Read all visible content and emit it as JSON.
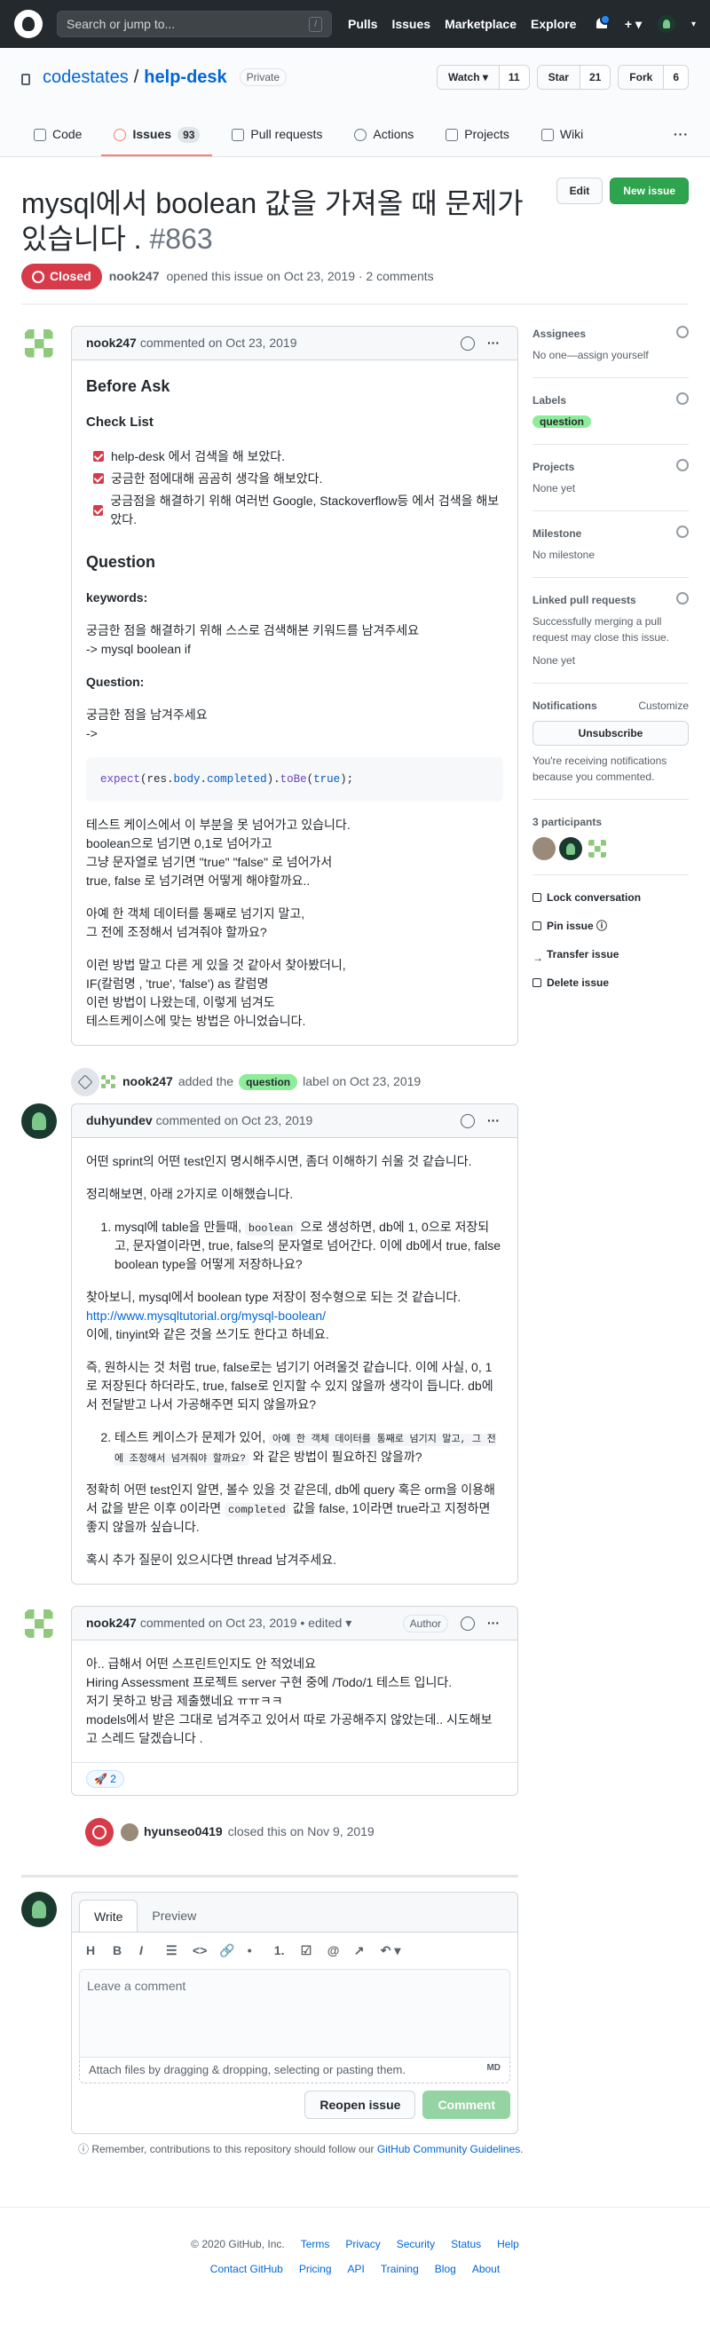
{
  "header": {
    "search_placeholder": "Search or jump to...",
    "search_key": "/",
    "nav": [
      "Pulls",
      "Issues",
      "Marketplace",
      "Explore"
    ],
    "plus": "+ ▾"
  },
  "repo": {
    "owner": "codestates",
    "sep": "/",
    "name": "help-desk",
    "visibility": "Private",
    "watch_label": "Watch ▾",
    "watch_count": "11",
    "star_label": "Star",
    "star_count": "21",
    "fork_label": "Fork",
    "fork_count": "6"
  },
  "tabs": [
    {
      "label": "Code"
    },
    {
      "label": "Issues",
      "count": "93"
    },
    {
      "label": "Pull requests"
    },
    {
      "label": "Actions"
    },
    {
      "label": "Projects"
    },
    {
      "label": "Wiki"
    }
  ],
  "issue": {
    "title": "mysql에서 boolean 값을 가져올 때 문제가 있습니다 .",
    "number": "#863",
    "edit_label": "Edit",
    "new_issue_label": "New issue",
    "status": "Closed",
    "author": "nook247",
    "meta": "opened this issue on Oct 23, 2019 · 2 comments"
  },
  "comments": [
    {
      "author": "nook247",
      "meta": "commented on Oct 23, 2019",
      "h_before": "Before Ask",
      "h_check": "Check List",
      "checks": [
        "help-desk 에서 검색을 해 보았다.",
        "궁금한 점에대해 곰곰히 생각을 해보았다.",
        "궁금점을 해결하기 위해 여러번 Google, Stackoverflow등 에서 검색을 해보았다."
      ],
      "h_question": "Question",
      "h_keywords": "keywords:",
      "kw1": "궁금한 점을 해결하기 위해 스스로 검색해본 키워드를 남겨주세요",
      "kw2": "-> mysql boolean if",
      "h_q": "Question:",
      "q1": "궁금한 점을 남겨주세요",
      "q2": "->",
      "code_fn": "expect",
      "code_a": "(res.",
      "code_b": "body",
      "code_c": ".",
      "code_d": "completed",
      "code_e": ").",
      "code_f": "toBe",
      "code_g": "(",
      "code_h": "true",
      "code_i": ");",
      "p1": [
        "테스트 케이스에서 이 부분을 못 넘어가고 있습니다.",
        "boolean으로 넘기면 0,1로 넘어가고",
        "그냥 문자열로 넘기면 \"true\" \"false\" 로 넘어가서",
        "true, false 로 넘기려면 어떻게 해야할까요.."
      ],
      "p2": [
        "아예 한 객체 데이터를 통째로 넘기지 말고,",
        "그 전에 조정해서 넘겨줘야 할까요?"
      ],
      "p3": [
        "이런 방법 말고 다른 게 있을 것 같아서 찾아봤더니,",
        "IF(칼럼명 , 'true', 'false') as 칼럼명",
        "이런 방법이 나왔는데, 이렇게 넘겨도",
        "테스트케이스에 맞는 방법은 아니었습니다."
      ]
    },
    {
      "author": "duhyundev",
      "meta": "commented on Oct 23, 2019",
      "p1": "어떤 sprint의 어떤 test인지 명시해주시면, 좀더 이해하기 쉬울 것 같습니다.",
      "p2": "정리해보면, 아래 2가지로 이해했습니다.",
      "li1_a": "mysql에 table을 만들때,",
      "li1_code": "boolean",
      "li1_b": "으로 생성하면, db에 1, 0으로 저장되고, 문자열이라면, true, false의 문자열로 넘어간다. 이에 db에서 true, false boolean type을 어떻게 저장하나요?",
      "p3": "찾아보니, mysql에서 boolean type 저장이 정수형으로 되는 것 같습니다.",
      "link": "http://www.mysqltutorial.org/mysql-boolean/",
      "p4": "이에, tinyint와 같은 것을 쓰기도 한다고 하네요.",
      "p5": "즉, 원하시는 것 처럼 true, false로는 넘기기 어려울것 같습니다. 이에 사실, 0, 1로 저장된다 하더라도, true, false로 인지할 수 있지 않을까 생각이 듭니다. db에서 전달받고 나서 가공해주면 되지 않을까요?",
      "li2_a": "테스트 케이스가 문제가 있어,",
      "li2_code": "아예 한 객체 데이터를 통째로 넘기지 말고, 그 전에 조정해서 넘겨줘야 할까요?",
      "li2_b": "와 같은 방법이 필요하진 않을까?",
      "p6_a": "정확히 어떤 test인지 알면, 볼수 있을 것 같은데, db에 query 혹은 orm을 이용해서 값을 받은 이후 0이라면",
      "p6_code": "completed",
      "p6_b": "값을 false, 1이라면 true라고 지정하면 좋지 않을까 싶습니다.",
      "p7": "혹시 추가 질문이 있으시다면 thread 남겨주세요."
    },
    {
      "author": "nook247",
      "meta": "commented on Oct 23, 2019 • edited ▾",
      "badge": "Author",
      "lines": [
        "아.. 급해서 어떤 스프린트인지도 안 적었네요",
        "Hiring Assessment 프로젝트 server 구현 중에 /Todo/1 테스트 입니다.",
        "저기 못하고 방금 제출했네요 ㅠㅠㅋㅋ",
        "models에서 받은 그대로 넘겨주고 있어서 따로 가공해주지 않았는데.. 시도해보고 스레드 달겠습니다 ."
      ],
      "reaction": "🚀 2"
    }
  ],
  "events": {
    "label_author": "nook247",
    "label_mid": "added the",
    "label_name": "question",
    "label_tail": "label on Oct 23, 2019",
    "close_author": "hyunseo0419",
    "close_tail": "closed this on Nov 9, 2019"
  },
  "sidebar": {
    "assignees_h": "Assignees",
    "assignees_v": "No one—assign yourself",
    "labels_h": "Labels",
    "label": "question",
    "projects_h": "Projects",
    "projects_v": "None yet",
    "milestone_h": "Milestone",
    "milestone_v": "No milestone",
    "linked_h": "Linked pull requests",
    "linked_note": "Successfully merging a pull request may close this issue.",
    "linked_v": "None yet",
    "notif_h": "Notifications",
    "customize": "Customize",
    "unsub": "Unsubscribe",
    "notif_note": "You're receiving notifications because you commented.",
    "participants_h": "3 participants",
    "lock": "Lock conversation",
    "pin": "Pin issue ⓘ",
    "transfer": "Transfer issue",
    "delete": "Delete issue"
  },
  "editor": {
    "write": "Write",
    "preview": "Preview",
    "tools": [
      "H",
      "B",
      "I",
      "☰",
      "<>",
      "🔗",
      "•",
      "1.",
      "☑",
      "@",
      "↗",
      "↶ ▾"
    ],
    "placeholder": "Leave a comment",
    "attach": "Attach files by dragging & dropping, selecting or pasting them.",
    "md": "MD",
    "reopen": "Reopen issue",
    "submit": "Comment",
    "tip_a": "ⓘ Remember, contributions to this repository should follow our",
    "tip_link": "GitHub Community Guidelines",
    "tip_b": "."
  },
  "footer": {
    "copy": "© 2020 GitHub, Inc.",
    "row1": [
      "Terms",
      "Privacy",
      "Security",
      "Status",
      "Help"
    ],
    "row2": [
      "Contact GitHub",
      "Pricing",
      "API",
      "Training",
      "Blog",
      "About"
    ]
  }
}
